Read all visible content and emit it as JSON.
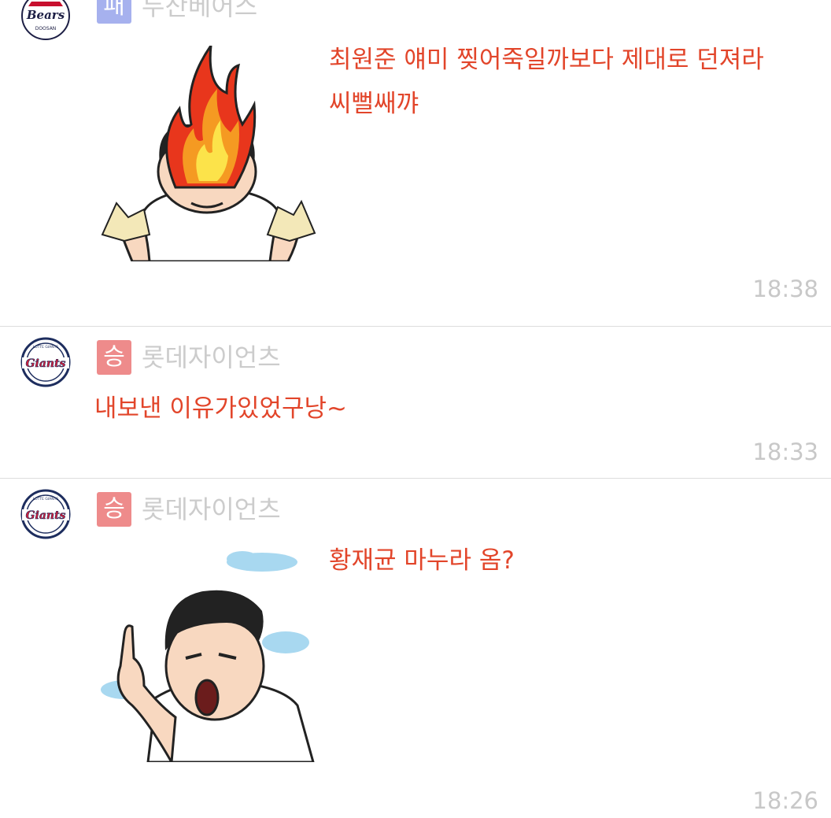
{
  "posts": [
    {
      "team_badge": "패",
      "team_name": "두산베어스",
      "team_logo": "Bears",
      "team_logo_sub": "DOOSAN",
      "message_lines": [
        "최원준 얘미 찢어죽일까보다 제대로 던져라",
        "씨뻘쌔꺄"
      ],
      "sticker": "angry-flame-head-sticker",
      "time": "18:38"
    },
    {
      "team_badge": "승",
      "team_name": "롯데자이언츠",
      "team_logo": "Giants",
      "team_logo_sub": "LOTTE GIANTS",
      "message_lines": [
        "내보낸 이유가있었구낭~"
      ],
      "time": "18:33"
    },
    {
      "team_badge": "승",
      "team_name": "롯데자이언츠",
      "team_logo": "Giants",
      "team_logo_sub": "LOTTE GIANTS",
      "message_lines": [
        "황재균 마누라 옴?"
      ],
      "sticker": "pointing-man-sticker",
      "time": "18:26"
    }
  ],
  "colors": {
    "message": "#e2452a",
    "lose_badge": "#a6b1ee",
    "win_badge": "#ee8b8b",
    "team_name": "#cccccc",
    "time": "#c8c8c8"
  }
}
